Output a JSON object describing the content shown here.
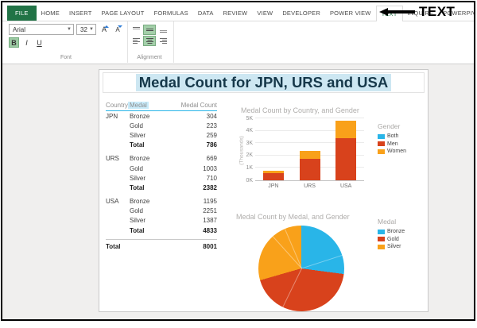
{
  "ribbon": {
    "tabs": [
      {
        "label": "FILE",
        "file": true
      },
      {
        "label": "HOME"
      },
      {
        "label": "INSERT"
      },
      {
        "label": "PAGE LAYOUT"
      },
      {
        "label": "FORMULAS"
      },
      {
        "label": "DATA"
      },
      {
        "label": "REVIEW"
      },
      {
        "label": "VIEW"
      },
      {
        "label": "DEVELOPER"
      },
      {
        "label": "POWER VIEW"
      },
      {
        "label": "TEXT",
        "selected": true
      },
      {
        "label": "INQUIRE"
      },
      {
        "label": "POWERPIVOT"
      }
    ],
    "annotation_label": "TEXT",
    "font": {
      "group_label": "Font",
      "name": "Arial",
      "size": "32",
      "bold_label": "B",
      "italic_label": "I",
      "underline_label": "U"
    },
    "alignment": {
      "group_label": "Alignment"
    }
  },
  "sheet": {
    "title": "Medal Count for JPN, URS and USA"
  },
  "table": {
    "headers": [
      "Country",
      "Medal",
      "Medal Count"
    ],
    "sort_indicator": "▲",
    "total_label": "Total",
    "groups": [
      {
        "country": "JPN",
        "rows": [
          [
            "Bronze",
            "304"
          ],
          [
            "Gold",
            "223"
          ],
          [
            "Silver",
            "259"
          ]
        ],
        "total": "786"
      },
      {
        "country": "URS",
        "rows": [
          [
            "Bronze",
            "669"
          ],
          [
            "Gold",
            "1003"
          ],
          [
            "Silver",
            "710"
          ]
        ],
        "total": "2382"
      },
      {
        "country": "USA",
        "rows": [
          [
            "Bronze",
            "1195"
          ],
          [
            "Gold",
            "2251"
          ],
          [
            "Silver",
            "1387"
          ]
        ],
        "total": "4833"
      }
    ],
    "grand_total_label": "Total",
    "grand_total": "8001"
  },
  "chart_data": [
    {
      "type": "bar",
      "stacked": true,
      "title": "Medal Count by Country, and Gender",
      "categories": [
        "JPN",
        "URS",
        "USA"
      ],
      "series": [
        {
          "name": "Both",
          "color": "#29b5e8",
          "values": [
            0,
            0,
            0
          ]
        },
        {
          "name": "Men",
          "color": "#d8421c",
          "values": [
            550,
            1700,
            3400
          ]
        },
        {
          "name": "Women",
          "color": "#f9a11a",
          "values": [
            236,
            682,
            1433
          ]
        }
      ],
      "ylabel": "(Thousands)",
      "yticks": [
        "0K",
        "1K",
        "2K",
        "3K",
        "4K",
        "5K"
      ],
      "ylim": [
        0,
        5000
      ],
      "legend_title": "Gender",
      "legend_position": "right",
      "grid": true
    },
    {
      "type": "pie",
      "title": "Medal Count by Medal, and Gender",
      "legend_title": "Medal",
      "legend_position": "right",
      "slices": [
        {
          "name": "Bronze",
          "color": "#29b5e8",
          "value": 2168
        },
        {
          "name": "Gold",
          "color": "#d8421c",
          "value": 3477
        },
        {
          "name": "Silver",
          "color": "#f9a11a",
          "value": 2356
        }
      ],
      "gender_divider_angles_deg": [
        72,
        206,
        318,
        337
      ]
    }
  ]
}
